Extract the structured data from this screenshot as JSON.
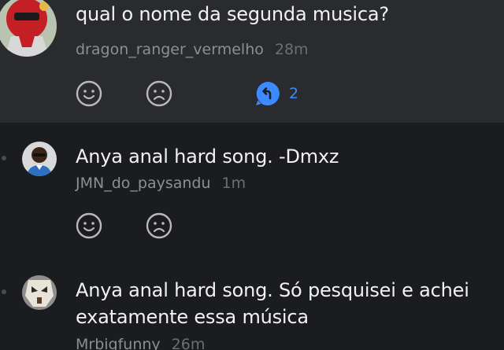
{
  "comments": [
    {
      "text": "qual o nome da segunda musica?",
      "username": "dragon_ranger_vermelho",
      "time": "28m",
      "reply_count": "2"
    },
    {
      "text": "Anya anal hard song. -Dmxz",
      "username": "JMN_do_paysandu",
      "time": "1m"
    },
    {
      "text": "Anya anal hard song. Só pesquisei e achei exatamente essa música",
      "username": "Mrbigfunny",
      "time": "26m"
    }
  ],
  "icons": {
    "upvote": "smile-icon",
    "downvote": "frown-icon",
    "replies": "reply-arrow-icon"
  },
  "colors": {
    "background": "#1b1c1f",
    "parent_background": "#2a2b2f",
    "accent": "#3b8bff",
    "text": "#f2f2f2",
    "meta": "#8d8e93"
  }
}
